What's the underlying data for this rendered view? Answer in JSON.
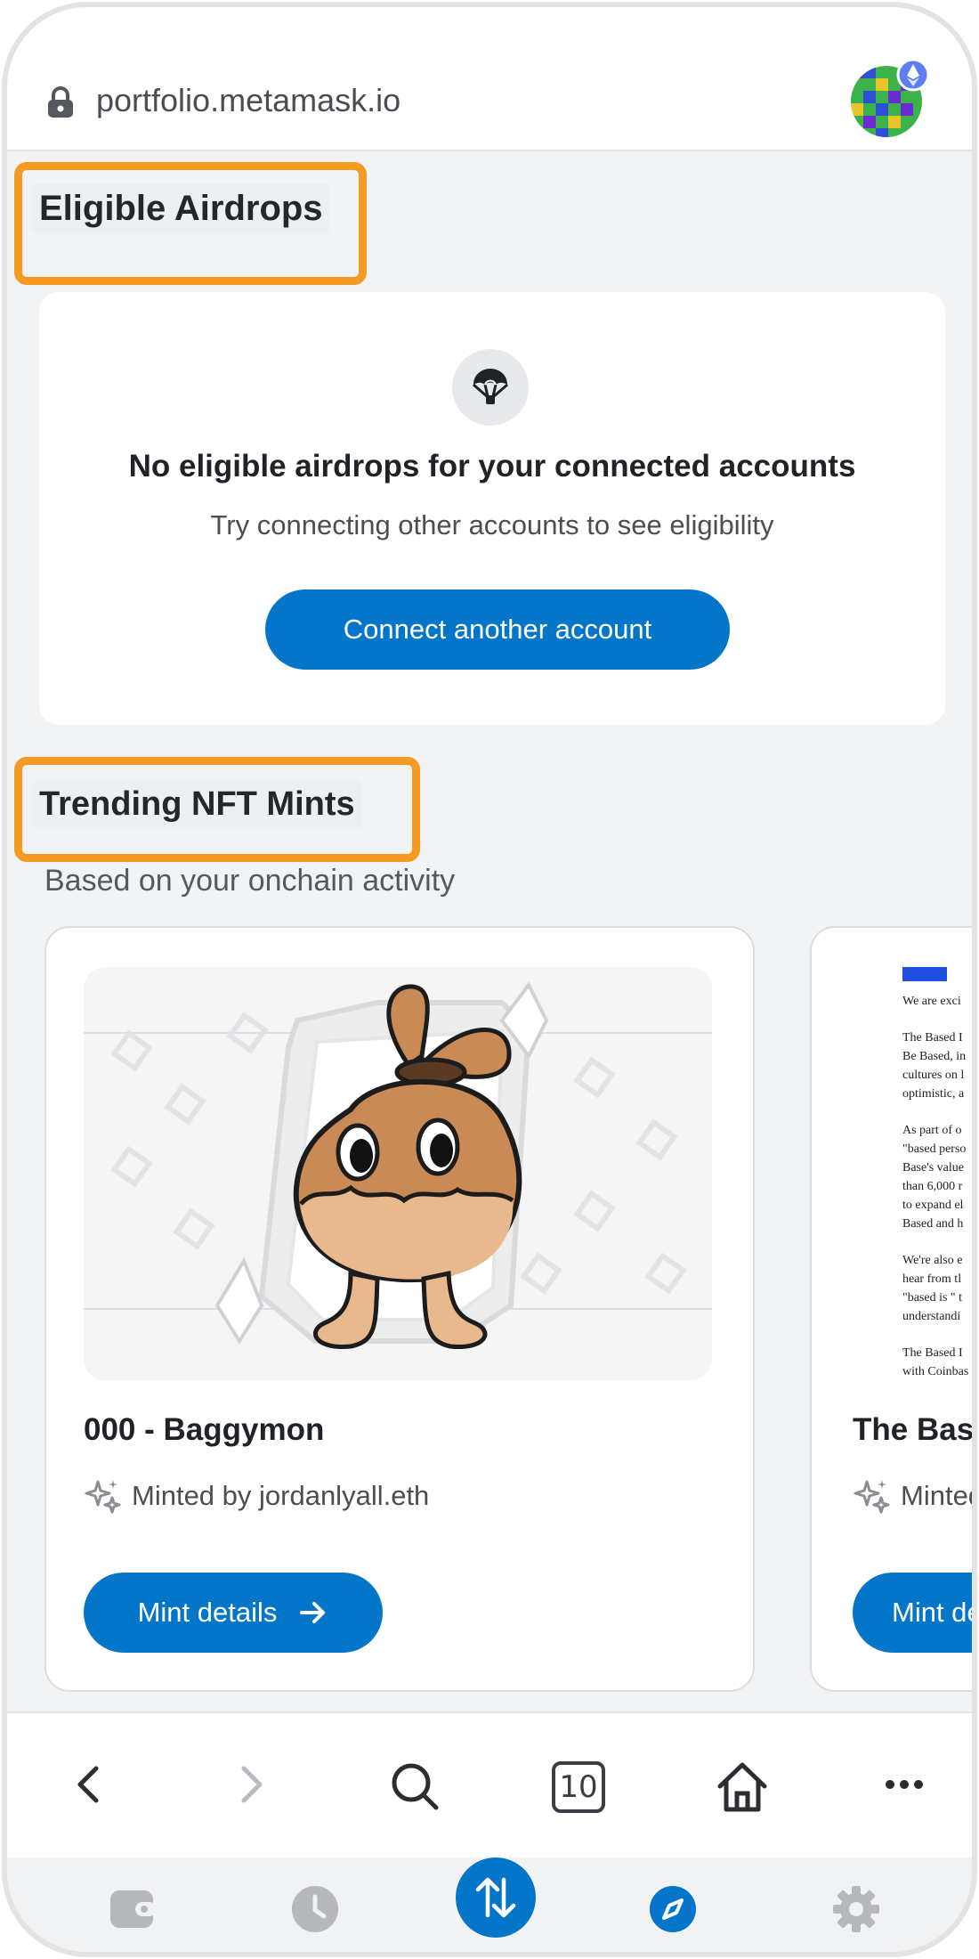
{
  "browser": {
    "url": "portfolio.metamask.io"
  },
  "airdrops": {
    "title": "Eligible Airdrops",
    "empty_title": "No eligible airdrops for your connected accounts",
    "empty_subtitle": "Try connecting other accounts to see eligibility",
    "connect_button": "Connect another account"
  },
  "nft_mints": {
    "title": "Trending NFT Mints",
    "subtitle": "Based on your onchain activity",
    "cards": [
      {
        "name": "000 - Baggymon",
        "minted_by": "Minted by jordanlyall.eth",
        "button": "Mint details"
      },
      {
        "name": "The Base",
        "minted_by": "Minted",
        "button": "Mint de",
        "doc_lines": [
          "We are exci",
          "The Based I",
          "Be Based, in",
          "cultures on l",
          "optimistic, a",
          "As part of o",
          "\"based perso",
          "Base's value",
          "than 6,000 r",
          "to expand el",
          "Based and h",
          "We're also e",
          "hear from tl",
          "\"based is \" t",
          "understandi",
          "The Based I",
          "with Coinbas"
        ]
      }
    ]
  },
  "browser_nav": {
    "tab_count": "10"
  },
  "colors": {
    "primary": "#0376c9",
    "highlight": "#f59b23",
    "background": "#f2f3f5"
  }
}
